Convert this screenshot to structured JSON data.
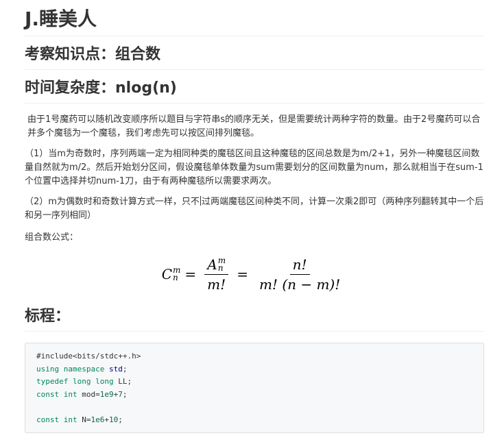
{
  "title": "J.睡美人",
  "knowledge": "考察知识点：组合数",
  "complexity": "时间复杂度：nlog(n)",
  "paragraphs": [
    "由于1号魔药可以随机改变顺序所以题目与字符串s的顺序无关，但是需要统计两种字符的数量。由于2号魔药可以合并多个魔毯为一个魔毯，我们考虑先可以按区间排列魔毯。",
    "（1）当m为奇数时，序列两端一定为相同种类的魔毯区间且这种魔毯的区间总数是为m/2+1，另外一种魔毯区间数量自然就为m/2。然后开始划分区间，假设魔毯单体数量为sum需要划分的区间数量为num，那么就相当于在sum-1个位置中选择并切num-1刀，由于有两种魔毯所以需要求两次。",
    "（2）m为偶数时和奇数计算方式一样，只不过两端魔毯区间种类不同，计算一次乘2即可（两种序列翻转其中一个后和另一序列相同）",
    "组合数公式："
  ],
  "formula": {
    "lhs_base": "C",
    "lhs_sup": "m",
    "lhs_sub": "n",
    "eq": "=",
    "frac1_num_base": "A",
    "frac1_num_sup": "m",
    "frac1_num_sub": "n",
    "frac1_den": "m!",
    "frac2_num": "n!",
    "frac2_den": "m! (n − m)!"
  },
  "procedure_heading": "标程：",
  "code": {
    "line1": "#include<bits/stdc++.h>",
    "line2_kw": "using namespace",
    "line2_ns": "std",
    "line2_end": ";",
    "line3_kw": "typedef",
    "line3_ty": "long long",
    "line3_rest": "LL;",
    "line4_kw": "const",
    "line4_ty": "int",
    "line4_rest": "mod=",
    "line4_num": "1e9",
    "line4_plus": "+",
    "line4_num2": "7",
    "line4_end": ";",
    "line6_kw": "const",
    "line6_ty": "int",
    "line6_rest": "N=",
    "line6_num": "1e6",
    "line6_plus": "+",
    "line6_num2": "10",
    "line6_end": ";"
  },
  "colors": {
    "keyword": "#008855",
    "namespace": "#000088",
    "code_bg": "#f6f8fa",
    "divider": "#eeeeee"
  }
}
